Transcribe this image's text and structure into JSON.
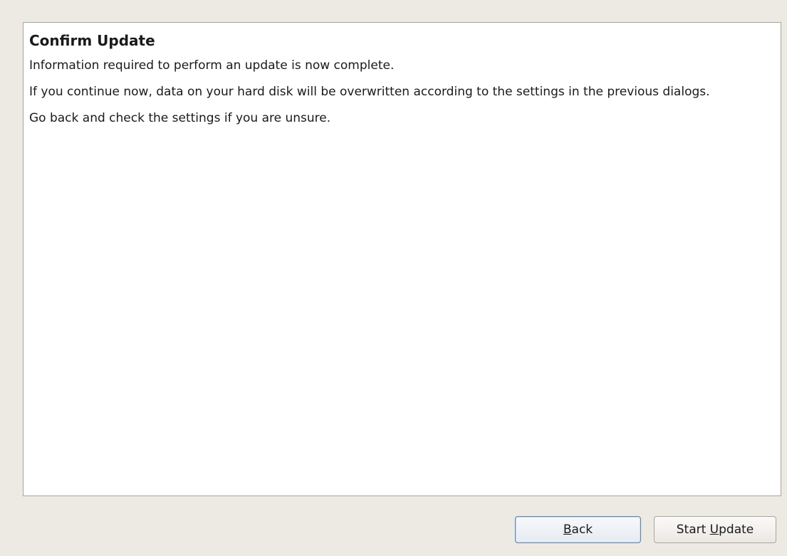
{
  "panel": {
    "title": "Confirm Update",
    "paragraphs": [
      "Information required to perform an update is now complete.",
      "If you continue now, data on your hard disk will be overwritten according to the settings in the previous dialogs.",
      "Go back and check the settings if you are unsure."
    ]
  },
  "buttons": {
    "back": {
      "pre": "",
      "mnemonic": "B",
      "post": "ack"
    },
    "start_update": {
      "pre": "Start ",
      "mnemonic": "U",
      "post": "pdate"
    }
  },
  "colors": {
    "window_bg": "#ede9e3",
    "panel_bg": "#ffffff",
    "focus_border": "#5f87b5"
  }
}
